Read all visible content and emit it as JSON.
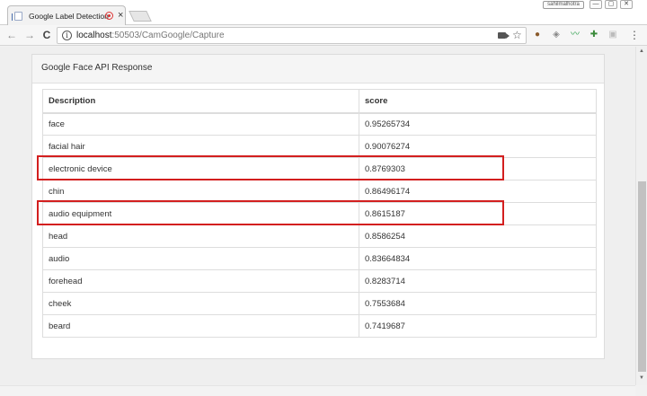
{
  "browser": {
    "tab_title": "Google Label Detection",
    "tab_close": "×",
    "profile_label": "sahilmalhotra",
    "window_minimize": "—",
    "window_maximize": "▢",
    "window_close": "✕",
    "url_host": "localhost",
    "url_rest": ":50503/CamGoogle/Capture",
    "back": "←",
    "forward": "→",
    "reload": "C",
    "info": "i",
    "star": "☆",
    "menu": "⋮",
    "extensions": [
      {
        "icon": "cookie-icon",
        "glyph": "●",
        "color": "#8a5a2b"
      },
      {
        "icon": "shield-icon",
        "glyph": "◈",
        "color": "#888888"
      },
      {
        "icon": "wave-icon",
        "glyph": "〰",
        "color": "#2a9d4a"
      },
      {
        "icon": "puzzle-icon",
        "glyph": "✚",
        "color": "#3a8a3a"
      },
      {
        "icon": "lock-icon",
        "glyph": "▣",
        "color": "#bbbbbb"
      }
    ]
  },
  "panel": {
    "heading": "Google Face API Response",
    "columns": [
      "Description",
      "score"
    ],
    "rows": [
      {
        "description": "face",
        "score": "0.95265734",
        "highlighted": false
      },
      {
        "description": "facial hair",
        "score": "0.90076274",
        "highlighted": false
      },
      {
        "description": "electronic device",
        "score": "0.8769303",
        "highlighted": true
      },
      {
        "description": "chin",
        "score": "0.86496174",
        "highlighted": false
      },
      {
        "description": "audio equipment",
        "score": "0.8615187",
        "highlighted": true
      },
      {
        "description": "head",
        "score": "0.8586254",
        "highlighted": false
      },
      {
        "description": "audio",
        "score": "0.83664834",
        "highlighted": false
      },
      {
        "description": "forehead",
        "score": "0.8283714",
        "highlighted": false
      },
      {
        "description": "cheek",
        "score": "0.7553684",
        "highlighted": false
      },
      {
        "description": "beard",
        "score": "0.7419687",
        "highlighted": false
      }
    ]
  },
  "colors": {
    "highlight_border": "#d31f1f",
    "panel_heading_bg": "#f5f5f5"
  }
}
